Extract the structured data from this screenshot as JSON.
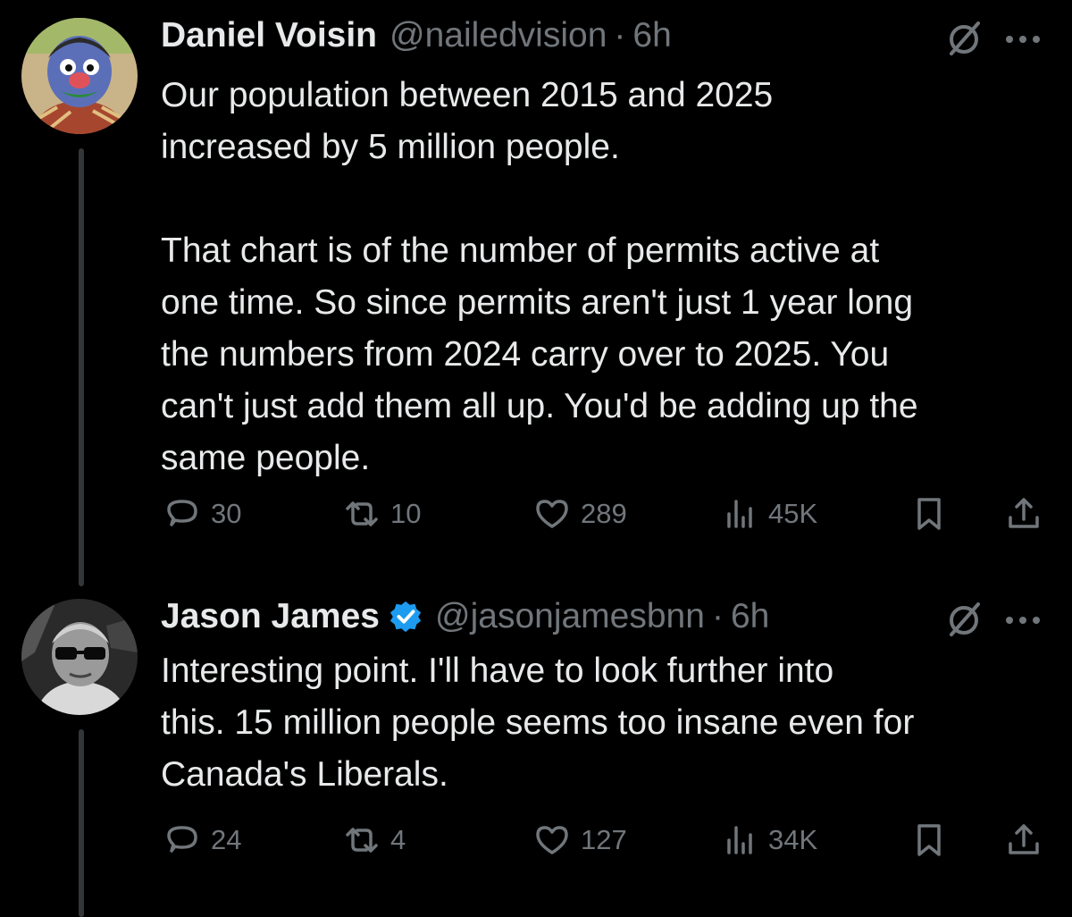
{
  "tweets": [
    {
      "author": "Daniel Voisin",
      "handle": "@nailedvision",
      "separator": "·",
      "time": "6h",
      "verified": false,
      "text": "Our population between 2015 and 2025\nincreased by 5 million people.\n\nThat chart is of the number of permits active at\none time. So since permits aren't just 1 year long\nthe numbers from 2024 carry over to 2025. You\ncan't just add them all up. You'd be adding up the\nsame people.",
      "replies": "30",
      "reposts": "10",
      "likes": "289",
      "views": "45K",
      "avatar_icon": "puppet-avatar"
    },
    {
      "author": "Jason James",
      "handle": "@jasonjamesbnn",
      "separator": "·",
      "time": "6h",
      "verified": true,
      "text": "Interesting point. I'll have to look further into\nthis. 15 million people seems too insane even for\nCanada's Liberals.",
      "replies": "24",
      "reposts": "4",
      "likes": "127",
      "views": "34K",
      "avatar_icon": "sunglasses-avatar"
    }
  ],
  "colors": {
    "background": "#000000",
    "text": "#e7e9ea",
    "muted": "#71767b",
    "verified": "#1d9bf0",
    "thread_line": "#333639"
  },
  "icons": [
    "reply-icon",
    "repost-icon",
    "like-icon",
    "views-icon",
    "bookmark-icon",
    "share-icon",
    "grok-icon",
    "more-icon",
    "verified-badge-icon"
  ]
}
